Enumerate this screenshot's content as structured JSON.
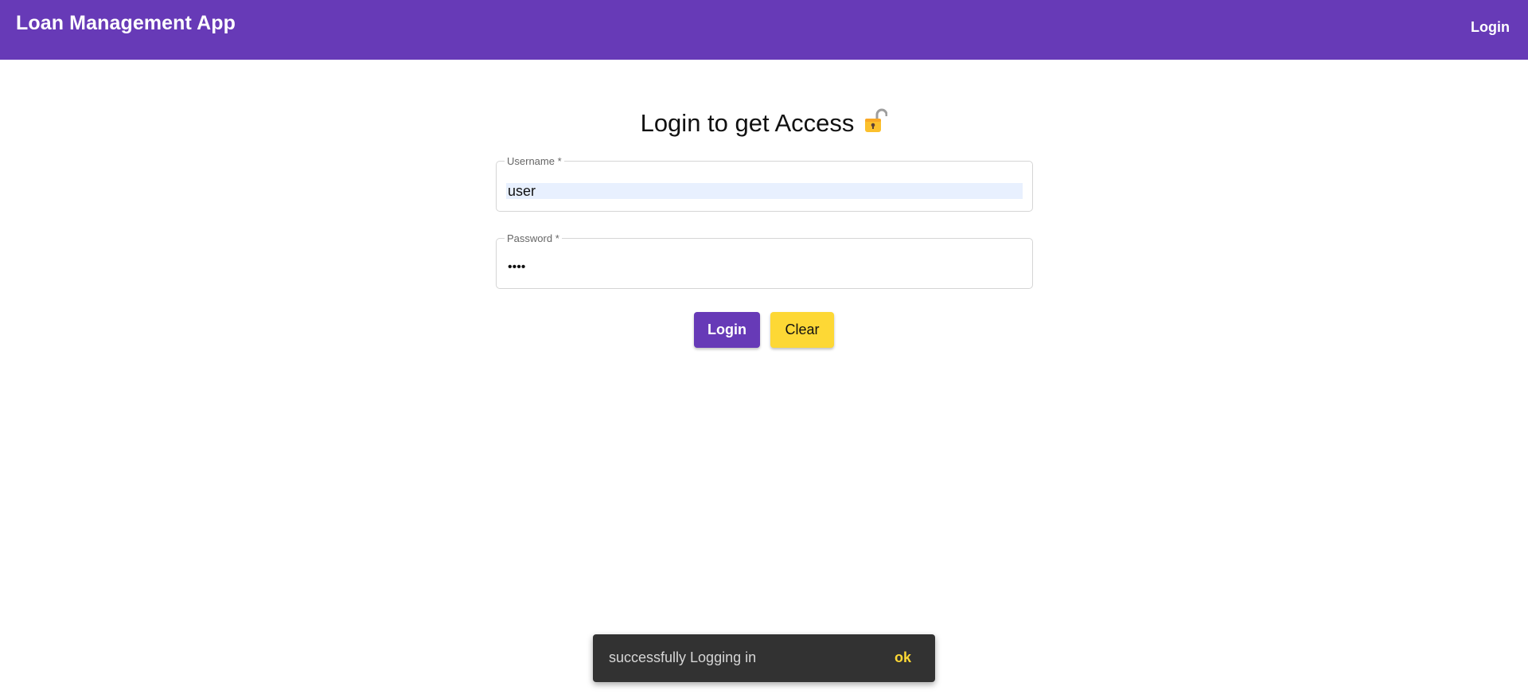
{
  "app": {
    "title": "Loan Management App",
    "nav_login": "Login",
    "brand_color": "#673ab7",
    "accent_color": "#fdd835"
  },
  "form": {
    "heading": "Login to get Access",
    "heading_icon": "lock-icon",
    "username": {
      "label": "Username *",
      "value": "user"
    },
    "password": {
      "label": "Password *",
      "value": "••••"
    },
    "login_button": "Login",
    "clear_button": "Clear"
  },
  "snackbar": {
    "message": "successfully Logging in",
    "action": "ok"
  }
}
